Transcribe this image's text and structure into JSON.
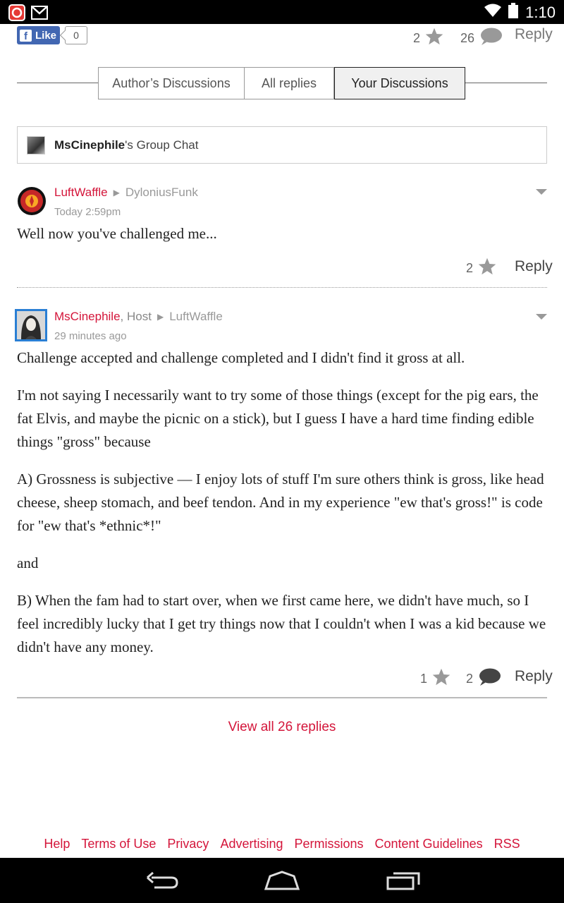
{
  "status": {
    "time": "1:10"
  },
  "top": {
    "like_label": "Like",
    "like_count": "0",
    "stars": "2",
    "comments": "26",
    "reply": "Reply"
  },
  "tabs": [
    {
      "label": "Author’s Discussions",
      "active": false
    },
    {
      "label": "All replies",
      "active": false
    },
    {
      "label": "Your Discussions",
      "active": true
    }
  ],
  "group_chat": {
    "owner": "MsCinephile",
    "suffix": "'s Group Chat"
  },
  "comments": [
    {
      "author": "LuftWaffle",
      "host_label": "",
      "to": "DyloniusFunk",
      "time": "Today 2:59pm",
      "paragraphs": [
        "Well now you've challenged me..."
      ],
      "stars": "2",
      "reply": "Reply"
    },
    {
      "author": "MsCinephile",
      "host_label": ", Host",
      "to": "LuftWaffle",
      "time": "29 minutes ago",
      "paragraphs": [
        "Challenge accepted and challenge completed and I didn't find it gross at all.",
        "I'm not saying I necessarily want to try some of those things (except for the pig ears, the fat Elvis, and maybe the picnic on a stick), but I guess I have a hard time finding edible things \"gross\" because",
        "A) Grossness is subjective — I enjoy lots of stuff I'm sure others think is gross, like head cheese, sheep stomach, and beef tendon. And in my experience \"ew that's gross!\" is code for \"ew that's *ethnic*!\"",
        "and",
        "B) When the fam had to start over, when we first came here, we didn't have much, so I feel incredibly lucky that I get try things now that I couldn't when I was a kid because we didn't have any money."
      ],
      "stars": "1",
      "comment_count": "2",
      "reply": "Reply"
    }
  ],
  "view_all": "View all 26 replies",
  "footer_links": [
    "Help",
    "Terms of Use",
    "Privacy",
    "Advertising",
    "Permissions",
    "Content Guidelines",
    "RSS"
  ],
  "colors": {
    "accent": "#d4153a",
    "facebook": "#4267b2"
  },
  "icons": [
    "app-icon",
    "gmail-icon",
    "wifi-icon",
    "battery-icon",
    "star-icon",
    "comment-icon",
    "back-icon",
    "home-icon",
    "recents-icon"
  ]
}
